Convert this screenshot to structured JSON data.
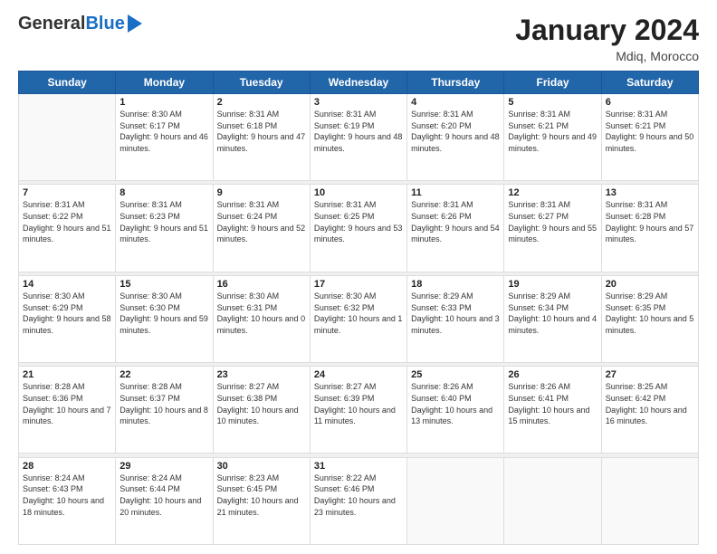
{
  "header": {
    "logo_general": "General",
    "logo_blue": "Blue",
    "title": "January 2024",
    "location": "Mdiq, Morocco"
  },
  "weekdays": [
    "Sunday",
    "Monday",
    "Tuesday",
    "Wednesday",
    "Thursday",
    "Friday",
    "Saturday"
  ],
  "weeks": [
    [
      {
        "day": null
      },
      {
        "day": 1,
        "sunrise": "Sunrise: 8:30 AM",
        "sunset": "Sunset: 6:17 PM",
        "daylight": "Daylight: 9 hours and 46 minutes."
      },
      {
        "day": 2,
        "sunrise": "Sunrise: 8:31 AM",
        "sunset": "Sunset: 6:18 PM",
        "daylight": "Daylight: 9 hours and 47 minutes."
      },
      {
        "day": 3,
        "sunrise": "Sunrise: 8:31 AM",
        "sunset": "Sunset: 6:19 PM",
        "daylight": "Daylight: 9 hours and 48 minutes."
      },
      {
        "day": 4,
        "sunrise": "Sunrise: 8:31 AM",
        "sunset": "Sunset: 6:20 PM",
        "daylight": "Daylight: 9 hours and 48 minutes."
      },
      {
        "day": 5,
        "sunrise": "Sunrise: 8:31 AM",
        "sunset": "Sunset: 6:21 PM",
        "daylight": "Daylight: 9 hours and 49 minutes."
      },
      {
        "day": 6,
        "sunrise": "Sunrise: 8:31 AM",
        "sunset": "Sunset: 6:21 PM",
        "daylight": "Daylight: 9 hours and 50 minutes."
      }
    ],
    [
      {
        "day": 7,
        "sunrise": "Sunrise: 8:31 AM",
        "sunset": "Sunset: 6:22 PM",
        "daylight": "Daylight: 9 hours and 51 minutes."
      },
      {
        "day": 8,
        "sunrise": "Sunrise: 8:31 AM",
        "sunset": "Sunset: 6:23 PM",
        "daylight": "Daylight: 9 hours and 51 minutes."
      },
      {
        "day": 9,
        "sunrise": "Sunrise: 8:31 AM",
        "sunset": "Sunset: 6:24 PM",
        "daylight": "Daylight: 9 hours and 52 minutes."
      },
      {
        "day": 10,
        "sunrise": "Sunrise: 8:31 AM",
        "sunset": "Sunset: 6:25 PM",
        "daylight": "Daylight: 9 hours and 53 minutes."
      },
      {
        "day": 11,
        "sunrise": "Sunrise: 8:31 AM",
        "sunset": "Sunset: 6:26 PM",
        "daylight": "Daylight: 9 hours and 54 minutes."
      },
      {
        "day": 12,
        "sunrise": "Sunrise: 8:31 AM",
        "sunset": "Sunset: 6:27 PM",
        "daylight": "Daylight: 9 hours and 55 minutes."
      },
      {
        "day": 13,
        "sunrise": "Sunrise: 8:31 AM",
        "sunset": "Sunset: 6:28 PM",
        "daylight": "Daylight: 9 hours and 57 minutes."
      }
    ],
    [
      {
        "day": 14,
        "sunrise": "Sunrise: 8:30 AM",
        "sunset": "Sunset: 6:29 PM",
        "daylight": "Daylight: 9 hours and 58 minutes."
      },
      {
        "day": 15,
        "sunrise": "Sunrise: 8:30 AM",
        "sunset": "Sunset: 6:30 PM",
        "daylight": "Daylight: 9 hours and 59 minutes."
      },
      {
        "day": 16,
        "sunrise": "Sunrise: 8:30 AM",
        "sunset": "Sunset: 6:31 PM",
        "daylight": "Daylight: 10 hours and 0 minutes."
      },
      {
        "day": 17,
        "sunrise": "Sunrise: 8:30 AM",
        "sunset": "Sunset: 6:32 PM",
        "daylight": "Daylight: 10 hours and 1 minute."
      },
      {
        "day": 18,
        "sunrise": "Sunrise: 8:29 AM",
        "sunset": "Sunset: 6:33 PM",
        "daylight": "Daylight: 10 hours and 3 minutes."
      },
      {
        "day": 19,
        "sunrise": "Sunrise: 8:29 AM",
        "sunset": "Sunset: 6:34 PM",
        "daylight": "Daylight: 10 hours and 4 minutes."
      },
      {
        "day": 20,
        "sunrise": "Sunrise: 8:29 AM",
        "sunset": "Sunset: 6:35 PM",
        "daylight": "Daylight: 10 hours and 5 minutes."
      }
    ],
    [
      {
        "day": 21,
        "sunrise": "Sunrise: 8:28 AM",
        "sunset": "Sunset: 6:36 PM",
        "daylight": "Daylight: 10 hours and 7 minutes."
      },
      {
        "day": 22,
        "sunrise": "Sunrise: 8:28 AM",
        "sunset": "Sunset: 6:37 PM",
        "daylight": "Daylight: 10 hours and 8 minutes."
      },
      {
        "day": 23,
        "sunrise": "Sunrise: 8:27 AM",
        "sunset": "Sunset: 6:38 PM",
        "daylight": "Daylight: 10 hours and 10 minutes."
      },
      {
        "day": 24,
        "sunrise": "Sunrise: 8:27 AM",
        "sunset": "Sunset: 6:39 PM",
        "daylight": "Daylight: 10 hours and 11 minutes."
      },
      {
        "day": 25,
        "sunrise": "Sunrise: 8:26 AM",
        "sunset": "Sunset: 6:40 PM",
        "daylight": "Daylight: 10 hours and 13 minutes."
      },
      {
        "day": 26,
        "sunrise": "Sunrise: 8:26 AM",
        "sunset": "Sunset: 6:41 PM",
        "daylight": "Daylight: 10 hours and 15 minutes."
      },
      {
        "day": 27,
        "sunrise": "Sunrise: 8:25 AM",
        "sunset": "Sunset: 6:42 PM",
        "daylight": "Daylight: 10 hours and 16 minutes."
      }
    ],
    [
      {
        "day": 28,
        "sunrise": "Sunrise: 8:24 AM",
        "sunset": "Sunset: 6:43 PM",
        "daylight": "Daylight: 10 hours and 18 minutes."
      },
      {
        "day": 29,
        "sunrise": "Sunrise: 8:24 AM",
        "sunset": "Sunset: 6:44 PM",
        "daylight": "Daylight: 10 hours and 20 minutes."
      },
      {
        "day": 30,
        "sunrise": "Sunrise: 8:23 AM",
        "sunset": "Sunset: 6:45 PM",
        "daylight": "Daylight: 10 hours and 21 minutes."
      },
      {
        "day": 31,
        "sunrise": "Sunrise: 8:22 AM",
        "sunset": "Sunset: 6:46 PM",
        "daylight": "Daylight: 10 hours and 23 minutes."
      },
      {
        "day": null
      },
      {
        "day": null
      },
      {
        "day": null
      }
    ]
  ]
}
